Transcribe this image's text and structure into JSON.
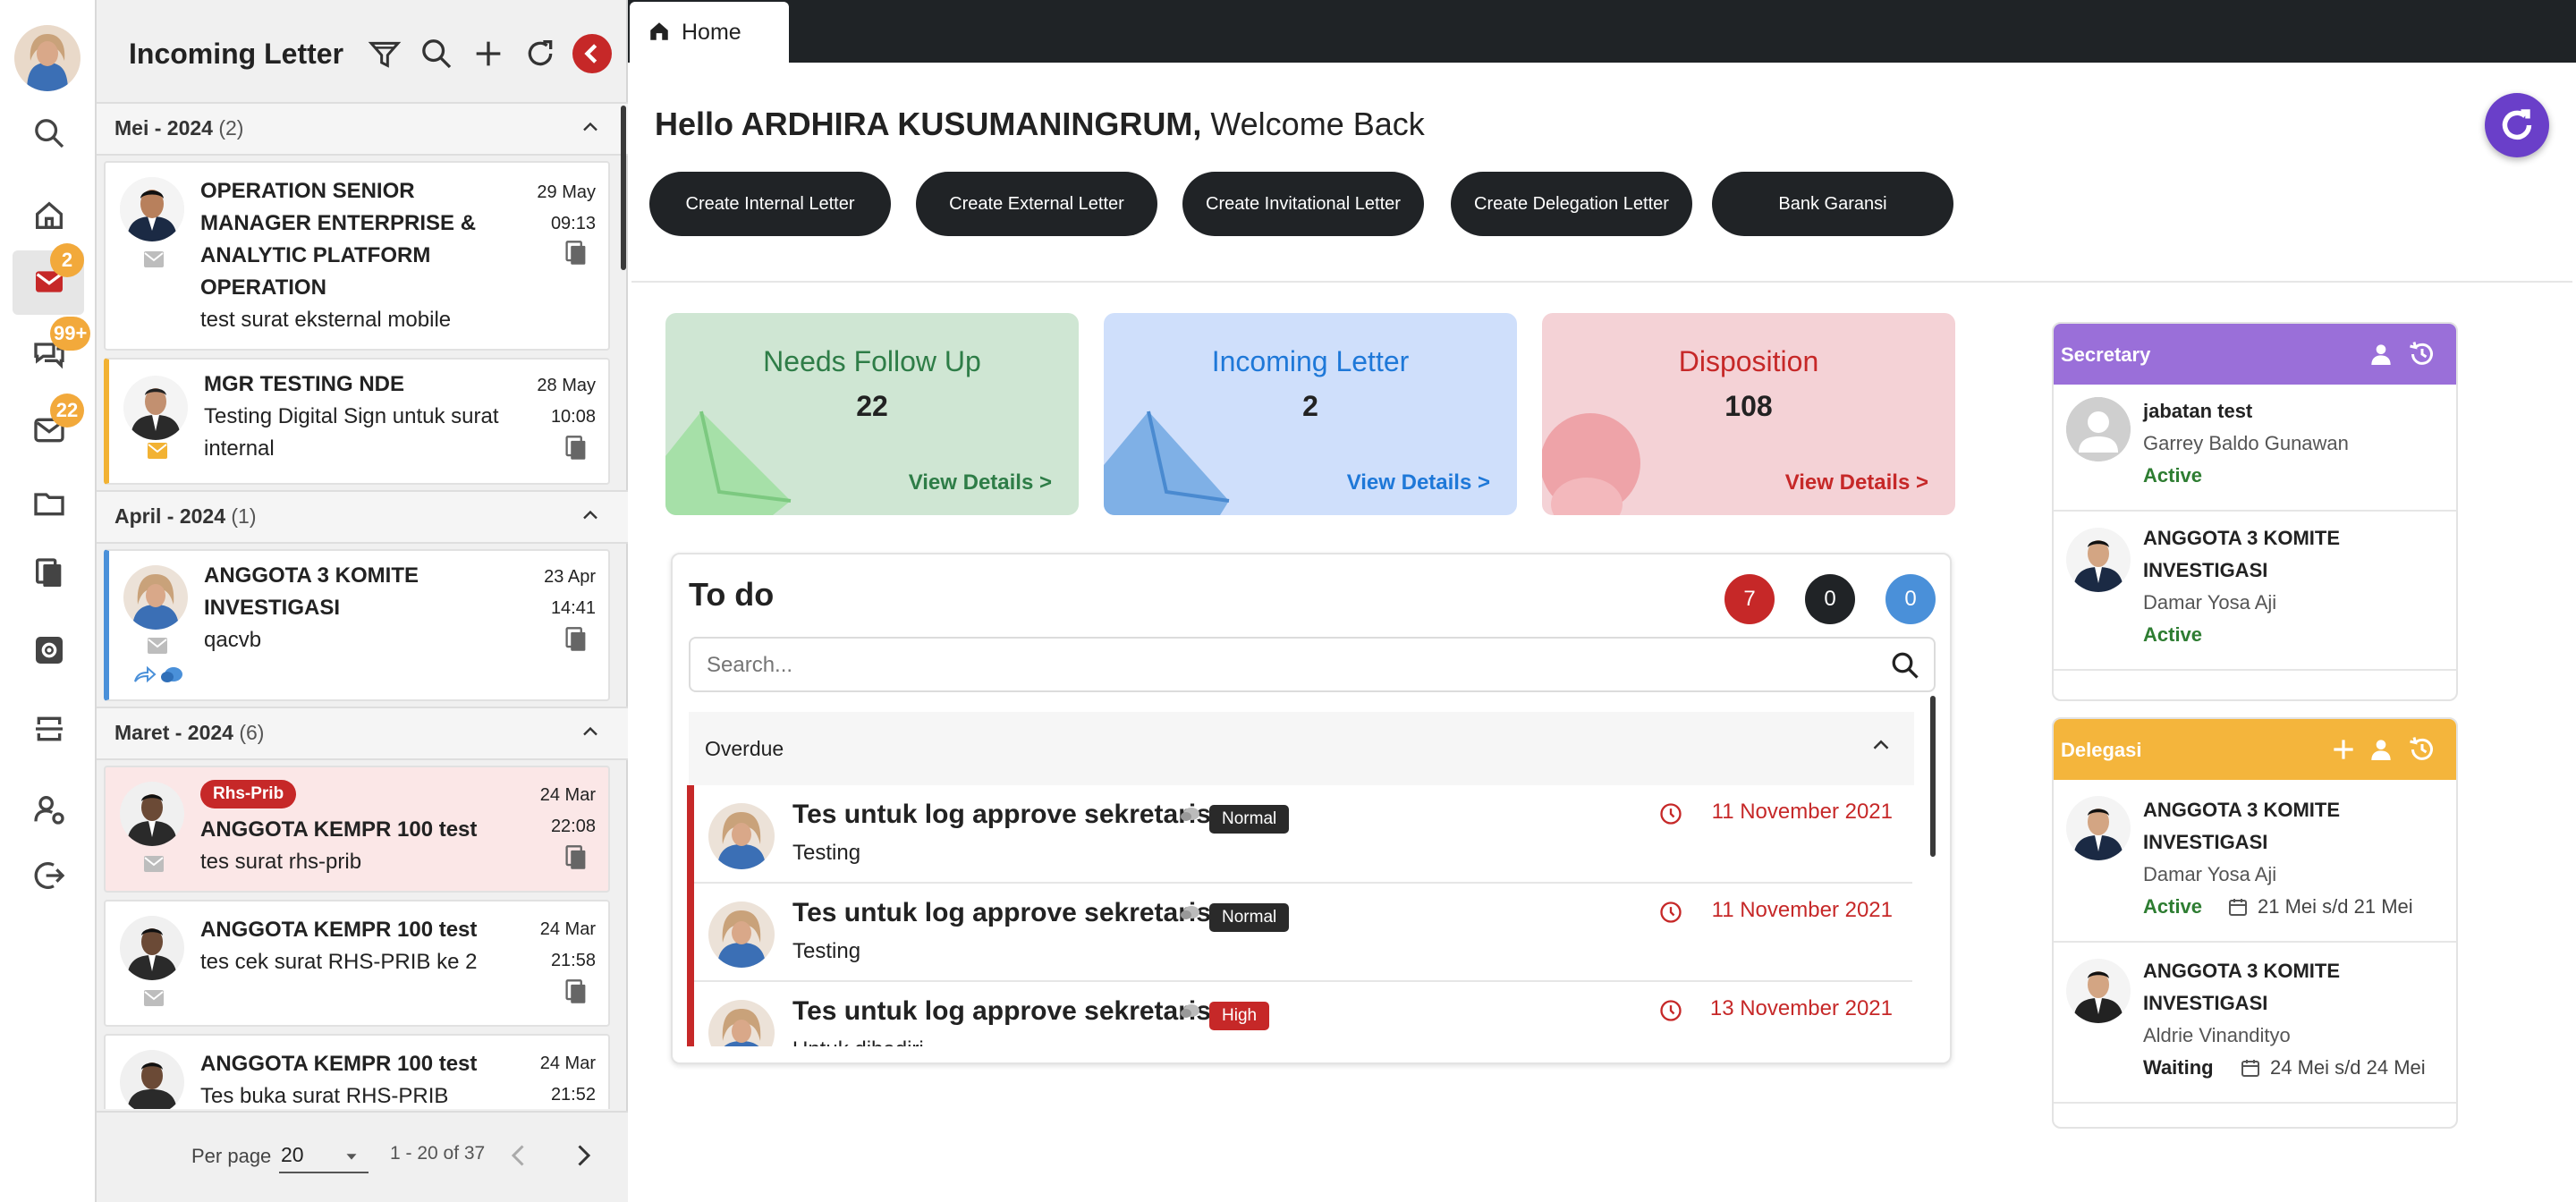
{
  "sidebar": {
    "badges": {
      "mail": "2",
      "chat": "99+",
      "inbox": "22"
    }
  },
  "panel": {
    "title": "Incoming Letter",
    "groups": [
      {
        "label": "Mei - 2024",
        "count": "(2)"
      },
      {
        "label": "April - 2024",
        "count": "(1)"
      },
      {
        "label": "Maret - 2024",
        "count": "(6)"
      }
    ],
    "letters": [
      {
        "title_lines": [
          "OPERATION SENIOR",
          "MANAGER ENTERPRISE &",
          "ANALYTIC PLATFORM",
          "OPERATION"
        ],
        "subject": "test surat eksternal mobile",
        "date": "29 May",
        "time": "09:13"
      },
      {
        "title_lines": [
          "MGR TESTING NDE"
        ],
        "subject_lines": [
          "Testing Digital Sign untuk surat",
          "internal"
        ],
        "date": "28 May",
        "time": "10:08"
      },
      {
        "title_lines": [
          "ANGGOTA 3 KOMITE",
          "INVESTIGASI"
        ],
        "subject": "qacvb",
        "date": "23 Apr",
        "time": "14:41"
      },
      {
        "tag": "Rhs-Prib",
        "title_lines": [
          "ANGGOTA KEMPR 100 test"
        ],
        "subject": "tes surat rhs-prib",
        "date": "24 Mar",
        "time": "22:08"
      },
      {
        "title_lines": [
          "ANGGOTA KEMPR 100 test"
        ],
        "subject": "tes cek surat RHS-PRIB ke 2",
        "date": "24 Mar",
        "time": "21:58"
      },
      {
        "title_lines": [
          "ANGGOTA KEMPR 100 test"
        ],
        "subject": "Tes buka surat RHS-PRIB",
        "date": "24 Mar",
        "time": "21:52"
      }
    ],
    "pagination": {
      "per_page_label": "Per page",
      "per_page_value": "20",
      "range": "1 - 20 of 37"
    }
  },
  "tabs": [
    {
      "label": "Home"
    }
  ],
  "home": {
    "greeting_name": "Hello ARDHIRA KUSUMANINGRUM,",
    "greeting_rest": " Welcome Back",
    "actions": [
      "Create Internal Letter",
      "Create External Letter",
      "Create Invitational Letter",
      "Create Delegation Letter",
      "Bank Garansi"
    ],
    "stats": [
      {
        "title": "Needs Follow Up",
        "value": "22",
        "link": "View Details >",
        "color": "#2e7d47",
        "bg": "#cfe6d3"
      },
      {
        "title": "Incoming Letter",
        "value": "2",
        "link": "View Details >",
        "color": "#1e78d8",
        "bg": "#cfdffb"
      },
      {
        "title": "Disposition",
        "value": "108",
        "link": "View Details >",
        "color": "#c62828",
        "bg": "#f4d2d6"
      }
    ]
  },
  "todo": {
    "title": "To do",
    "counts": [
      "7",
      "0",
      "0"
    ],
    "count_colors": [
      "#c62828",
      "#202326",
      "#4a90d9"
    ],
    "search_placeholder": "Search...",
    "section": "Overdue",
    "items": [
      {
        "title": "Tes untuk log approve sekretaris",
        "priority": "Normal",
        "subtitle": "Testing",
        "date": "11 November 2021"
      },
      {
        "title": "Tes untuk log approve sekretaris",
        "priority": "Normal",
        "subtitle": "Testing",
        "date": "11 November 2021"
      },
      {
        "title": "Tes untuk log approve sekretaris",
        "priority": "High",
        "subtitle": "Untuk dihadiri",
        "date": "13 November 2021"
      }
    ]
  },
  "secretary": {
    "title": "Secretary",
    "items": [
      {
        "position": "jabatan test",
        "name": "Garrey Baldo Gunawan",
        "status": "Active"
      },
      {
        "position_lines": [
          "ANGGOTA 3 KOMITE",
          "INVESTIGASI"
        ],
        "name": "Damar Yosa Aji",
        "status": "Active"
      }
    ]
  },
  "delegasi": {
    "title": "Delegasi",
    "items": [
      {
        "position_lines": [
          "ANGGOTA 3 KOMITE",
          "INVESTIGASI"
        ],
        "name": "Damar Yosa Aji",
        "status": "Active",
        "period": "21 Mei s/d 21 Mei"
      },
      {
        "position_lines": [
          "ANGGOTA 3 KOMITE",
          "INVESTIGASI"
        ],
        "name": "Aldrie Vinandityo",
        "status": "Waiting",
        "period": "24 Mei s/d 24 Mei"
      }
    ]
  }
}
